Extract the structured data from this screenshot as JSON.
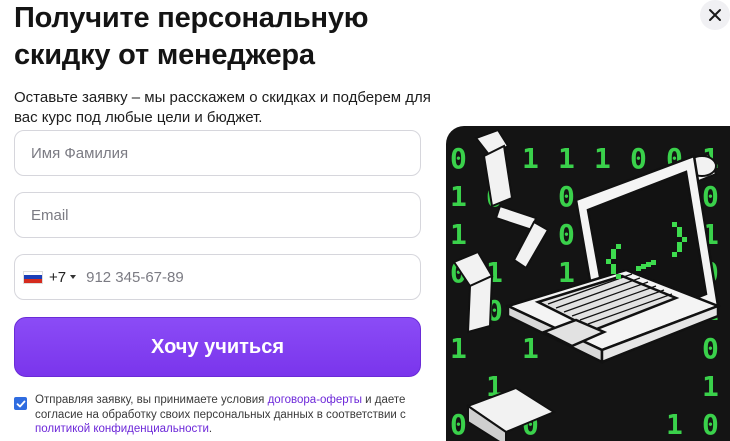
{
  "modal": {
    "title": "Получите персональную скидку от менеджера",
    "subtitle": "Оставьте заявку – мы расскажем о скидках и подберем для вас курс под любые цели и бюджет.",
    "close_icon": "close-icon"
  },
  "form": {
    "name_placeholder": "Имя Фамилия",
    "email_placeholder": "Email",
    "phone_country": "russia-flag-icon",
    "phone_code": "+7",
    "phone_placeholder": "912 345-67-89",
    "submit_label": "Хочу учиться",
    "consent": {
      "checked": true,
      "text_1": "Отправляя заявку, вы принимаете условия ",
      "link_1": "договора-оферты",
      "text_2": " и даете согласие на обработку своих персональных данных в соответствии с ",
      "link_2": "политикой конфиденциальности",
      "text_3": "."
    }
  },
  "illustration": {
    "icon": "laptop-code-illustration",
    "code_symbol": "{ _ }",
    "colors": {
      "background": "#141414",
      "code": "#3ddc4e",
      "outline": "#ffffff"
    }
  },
  "colors": {
    "accent": "#7c3aed",
    "link": "#6d28d9",
    "checkbox": "#2f6ce0",
    "border": "#d6d6dc"
  }
}
